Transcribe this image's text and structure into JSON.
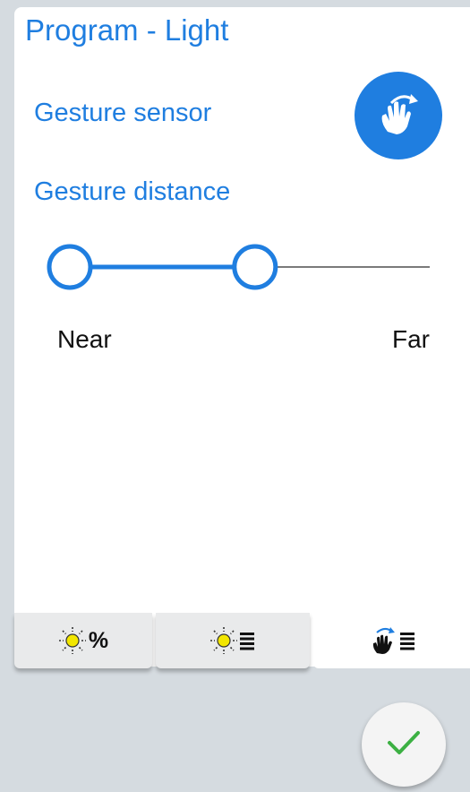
{
  "header": {
    "title": "Program - Light"
  },
  "gesture_sensor": {
    "label": "Gesture sensor",
    "icon": "hand-wave-icon",
    "enabled": true
  },
  "gesture_distance": {
    "label": "Gesture distance",
    "near_label": "Near",
    "far_label": "Far",
    "range_min_fraction": 0.0,
    "range_max_fraction": 0.55
  },
  "tabs": [
    {
      "icon": "sun-icon",
      "suffix": "%",
      "active": false
    },
    {
      "icon": "sun-icon",
      "suffix_icon": "list-icon",
      "active": false
    },
    {
      "icon": "hand-wave-icon",
      "suffix_icon": "list-icon",
      "active": true
    }
  ],
  "colors": {
    "accent": "#1f7ee0",
    "track_inactive": "#7a7a7a",
    "confirm_check": "#3cb043",
    "sun_yellow": "#f2e600"
  },
  "confirm": {
    "icon": "check-icon"
  }
}
